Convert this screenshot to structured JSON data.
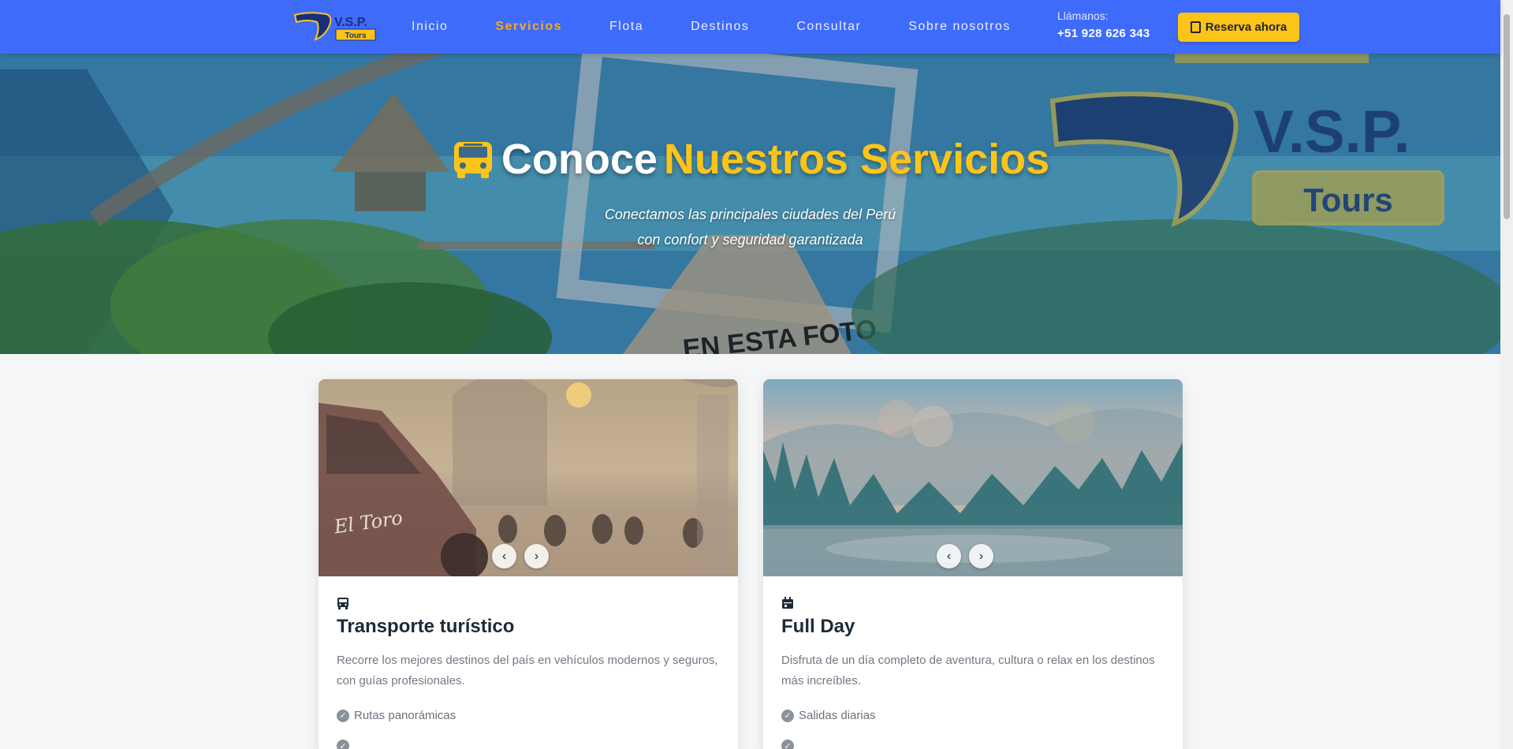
{
  "brand": {
    "logo_text": "V.S.P.",
    "logo_badge": "Tours"
  },
  "nav": {
    "items": [
      {
        "label": "Inicio"
      },
      {
        "label": "Servicios"
      },
      {
        "label": "Flota"
      },
      {
        "label": "Destinos"
      },
      {
        "label": "Consultar"
      },
      {
        "label": "Sobre nosotros"
      }
    ],
    "active": "Servicios",
    "call_label": "Llámanos:",
    "call_phone": "+51 928 626 343",
    "reserve_label": "Reserva ahora"
  },
  "hero": {
    "title_white": "Conoce",
    "title_accent": "Nuestros Servicios",
    "subtitle_line1": "Conectamos las principales ciudades del Perú",
    "subtitle_line2": "con confort y seguridad garantizada",
    "bg_logo_text": "V.S.P.",
    "bg_logo_badge": "Tours",
    "photo_caption": "EN ESTA FOTO"
  },
  "cards": [
    {
      "icon": "bus-icon",
      "title": "Transporte turístico",
      "description": "Recorre los mejores destinos del país en vehículos modernos y seguros, con guías profesionales.",
      "features": [
        "Rutas panorámicas"
      ],
      "image_text": "El Toro"
    },
    {
      "icon": "calendar-icon",
      "title": "Full Day",
      "description": "Disfruta de un día completo de aventura, cultura o relax en los destinos más increíbles.",
      "features": [
        "Salidas diarias"
      ]
    }
  ],
  "colors": {
    "nav_bg": "#3f6bfb",
    "accent": "#fcc419",
    "active_link": "#f7a823"
  }
}
